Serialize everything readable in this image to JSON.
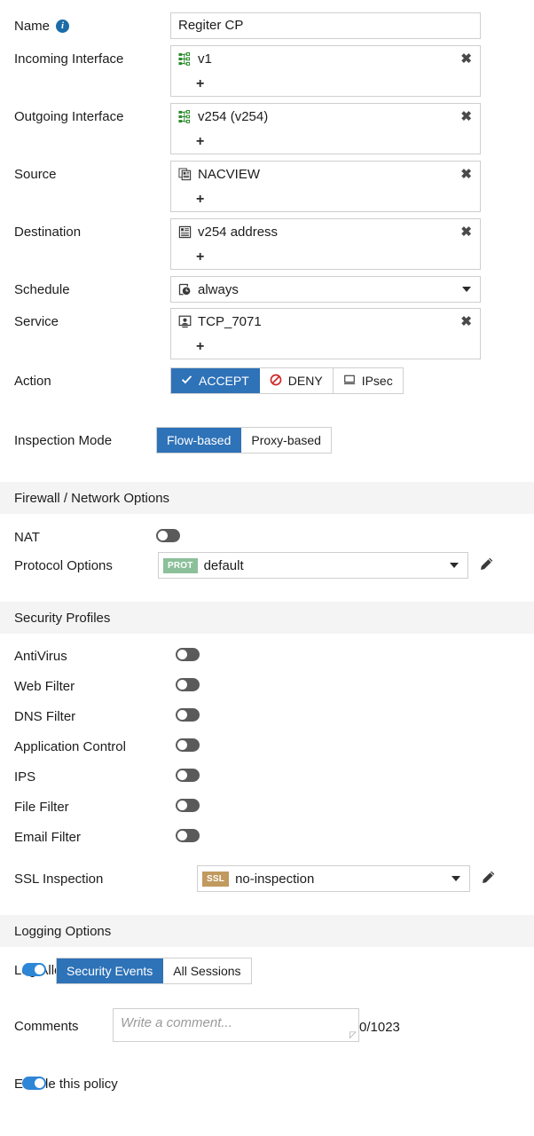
{
  "form": {
    "name": {
      "label": "Name",
      "info_icon": "info-icon",
      "value": "Regiter CP"
    },
    "incoming_interface": {
      "label": "Incoming Interface",
      "icon": "vlan-interface-icon",
      "items": [
        {
          "text": "v1"
        }
      ],
      "add_label": "+",
      "remove_label": "✖"
    },
    "outgoing_interface": {
      "label": "Outgoing Interface",
      "icon": "vlan-interface-icon",
      "items": [
        {
          "text": "v254 (v254)"
        }
      ],
      "add_label": "+",
      "remove_label": "✖"
    },
    "source": {
      "label": "Source",
      "icon": "address-group-icon",
      "items": [
        {
          "text": "NACVIEW"
        }
      ],
      "add_label": "+",
      "remove_label": "✖"
    },
    "destination": {
      "label": "Destination",
      "icon": "address-icon",
      "items": [
        {
          "text": "v254 address"
        }
      ],
      "add_label": "+",
      "remove_label": "✖"
    },
    "schedule": {
      "label": "Schedule",
      "icon": "schedule-clock-icon",
      "value": "always"
    },
    "service": {
      "label": "Service",
      "icon": "service-icon",
      "items": [
        {
          "text": "TCP_7071"
        }
      ],
      "add_label": "+",
      "remove_label": "✖"
    },
    "action": {
      "label": "Action",
      "options": [
        {
          "label": "ACCEPT",
          "icon": "check-icon",
          "selected": true
        },
        {
          "label": "DENY",
          "icon": "deny-icon",
          "selected": false
        },
        {
          "label": "IPsec",
          "icon": "monitor-icon",
          "selected": false
        }
      ]
    },
    "inspection_mode": {
      "label": "Inspection Mode",
      "options": [
        {
          "label": "Flow-based",
          "selected": true
        },
        {
          "label": "Proxy-based",
          "selected": false
        }
      ]
    }
  },
  "firewall_options": {
    "title": "Firewall / Network Options",
    "nat": {
      "label": "NAT",
      "on": false
    },
    "protocol_options": {
      "label": "Protocol Options",
      "badge": "PROT",
      "value": "default",
      "edit_icon": "pencil-icon"
    }
  },
  "security_profiles": {
    "title": "Security Profiles",
    "items": [
      {
        "label": "AntiVirus",
        "on": false
      },
      {
        "label": "Web Filter",
        "on": false
      },
      {
        "label": "DNS Filter",
        "on": false
      },
      {
        "label": "Application Control",
        "on": false
      },
      {
        "label": "IPS",
        "on": false
      },
      {
        "label": "File Filter",
        "on": false
      },
      {
        "label": "Email Filter",
        "on": false
      }
    ],
    "ssl_inspection": {
      "label": "SSL Inspection",
      "badge": "SSL",
      "value": "no-inspection",
      "edit_icon": "pencil-icon"
    }
  },
  "logging_options": {
    "title": "Logging Options",
    "log_allowed_traffic": {
      "label": "Log Allowed Traffic",
      "on": true,
      "options": [
        {
          "label": "Security Events",
          "selected": true
        },
        {
          "label": "All Sessions",
          "selected": false
        }
      ]
    },
    "comments": {
      "label": "Comments",
      "value": "",
      "placeholder": "Write a comment...",
      "counter": "0/1023"
    },
    "enable_policy": {
      "label": "Enable this policy",
      "on": true
    }
  },
  "colors": {
    "accent_blue": "#2e72b8",
    "toggle_on": "#2e86d6",
    "toggle_off": "#5a5a5a",
    "deny_red": "#d02828",
    "interface_green": "#2a8a2a",
    "prot_badge": "#8cc09a",
    "ssl_badge": "#c09a5e",
    "section_bg": "#f4f4f4",
    "border": "#cfcfcf"
  }
}
